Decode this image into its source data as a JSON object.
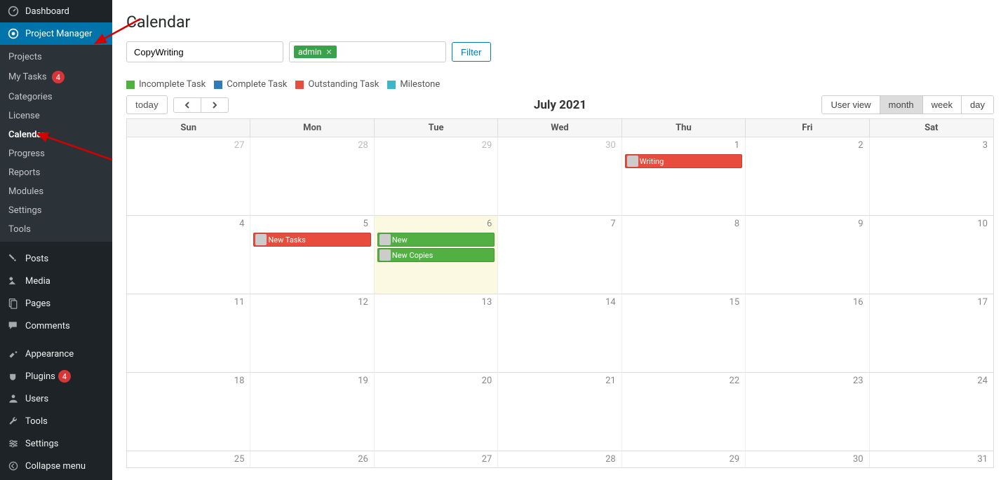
{
  "sidebar": {
    "dashboard": "Dashboard",
    "project_manager": "Project Manager",
    "pm_sub": {
      "projects": "Projects",
      "my_tasks": "My Tasks",
      "my_tasks_badge": "4",
      "categories": "Categories",
      "license": "License",
      "calendar": "Calendar",
      "progress": "Progress",
      "reports": "Reports",
      "modules": "Modules",
      "settings": "Settings",
      "tools": "Tools"
    },
    "posts": "Posts",
    "media": "Media",
    "pages": "Pages",
    "comments": "Comments",
    "appearance": "Appearance",
    "plugins": "Plugins",
    "plugins_badge": "4",
    "users": "Users",
    "tools": "Tools",
    "settings": "Settings",
    "collapse": "Collapse menu"
  },
  "page": {
    "title": "Calendar"
  },
  "filters": {
    "project_value": "CopyWriting",
    "tag_label": "admin",
    "filter_btn": "Filter"
  },
  "legend": {
    "incomplete": "Incomplete Task",
    "complete": "Complete Task",
    "outstanding": "Outstanding Task",
    "milestone": "Milestone"
  },
  "toolbar": {
    "today": "today",
    "month_label": "July 2021",
    "views": {
      "user": "User view",
      "month": "month",
      "week": "week",
      "day": "day"
    }
  },
  "day_headers": {
    "sun": "Sun",
    "mon": "Mon",
    "tue": "Tue",
    "wed": "Wed",
    "thu": "Thu",
    "fri": "Fri",
    "sat": "Sat"
  },
  "weeks": [
    {
      "d": [
        "27",
        "28",
        "29",
        "30",
        "1",
        "2",
        "3"
      ],
      "other": [
        true,
        true,
        true,
        true,
        false,
        false,
        false
      ]
    },
    {
      "d": [
        "4",
        "5",
        "6",
        "7",
        "8",
        "9",
        "10"
      ],
      "other": [
        false,
        false,
        false,
        false,
        false,
        false,
        false
      ]
    },
    {
      "d": [
        "11",
        "12",
        "13",
        "14",
        "15",
        "16",
        "17"
      ],
      "other": [
        false,
        false,
        false,
        false,
        false,
        false,
        false
      ]
    },
    {
      "d": [
        "18",
        "19",
        "20",
        "21",
        "22",
        "23",
        "24"
      ],
      "other": [
        false,
        false,
        false,
        false,
        false,
        false,
        false
      ]
    },
    {
      "d": [
        "25",
        "26",
        "27",
        "28",
        "29",
        "30",
        "31"
      ],
      "other": [
        false,
        false,
        false,
        false,
        false,
        false,
        false
      ]
    }
  ],
  "events": {
    "writing": "Writing",
    "new_tasks": "New Tasks",
    "new": "New",
    "new_copies": "New Copies"
  },
  "colors": {
    "accent": "#0073aa",
    "green": "#52b043",
    "blue": "#2e7bbf",
    "red": "#e74c3c",
    "teal": "#3cb7c7",
    "badge": "#d63638"
  }
}
